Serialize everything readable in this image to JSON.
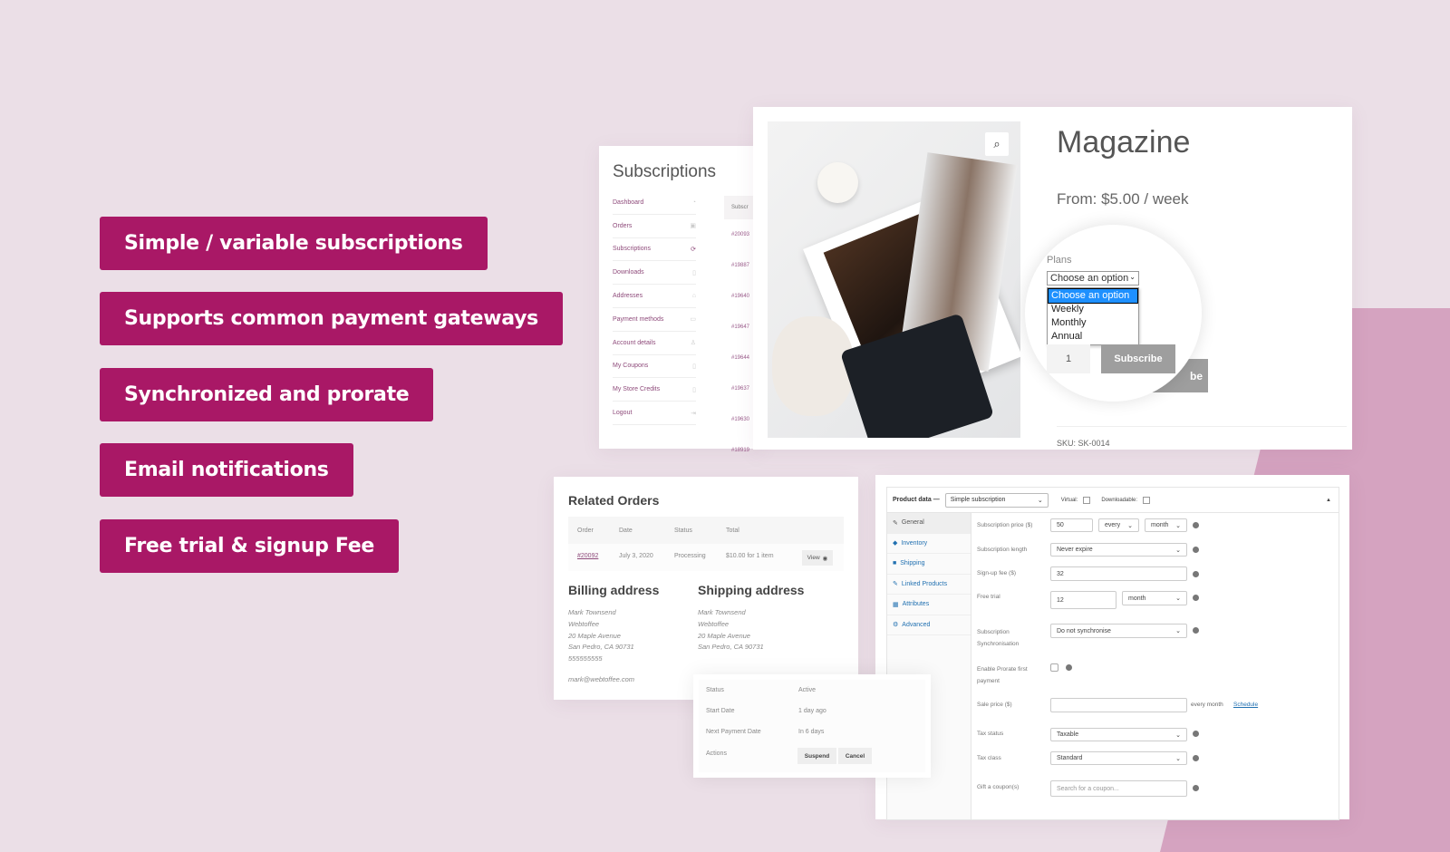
{
  "colors": {
    "accent": "#a91866",
    "background": "#ebdfe7",
    "blob": "#d5a3c0"
  },
  "features": [
    "Simple / variable subscriptions",
    "Supports common payment gateways",
    "Synchronized and prorate",
    "Email notifications",
    "Free trial & signup Fee"
  ],
  "account": {
    "title": "Subscriptions",
    "nav": [
      {
        "label": "Dashboard",
        "icon": "dashboard-icon"
      },
      {
        "label": "Orders",
        "icon": "orders-icon"
      },
      {
        "label": "Subscriptions",
        "icon": "refresh-icon"
      },
      {
        "label": "Downloads",
        "icon": "file-icon"
      },
      {
        "label": "Addresses",
        "icon": "home-icon"
      },
      {
        "label": "Payment methods",
        "icon": "card-icon"
      },
      {
        "label": "Account details",
        "icon": "user-icon"
      },
      {
        "label": "My Coupons",
        "icon": "coupon-icon"
      },
      {
        "label": "My Store Credits",
        "icon": "credit-icon"
      },
      {
        "label": "Logout",
        "icon": "logout-icon"
      }
    ],
    "column_header": "Subscr",
    "rows": [
      "#20093",
      "#19887",
      "#19640",
      "#19647",
      "#19644",
      "#19637",
      "#19630",
      "#18919"
    ]
  },
  "product": {
    "title": "Magazine",
    "price": "From: $5.00 / week",
    "plans_label": "Plans",
    "select_value": "Choose an option",
    "options": [
      "Choose an option",
      "Weekly",
      "Monthly",
      "Annual"
    ],
    "quantity": "1",
    "subscribe": "Subscribe",
    "subscribe_behind": "be",
    "sku": "SKU: SK-0014",
    "zoom_icon": "magnifier-icon"
  },
  "related": {
    "title": "Related Orders",
    "headers": [
      "Order",
      "Date",
      "Status",
      "Total"
    ],
    "row": {
      "order": "#20092",
      "date": "July 3, 2020",
      "status": "Processing",
      "total": "$10.00 for 1 item",
      "view": "View"
    },
    "billing_title": "Billing address",
    "billing": [
      "Mark Townsend",
      "Webtoffee",
      "20 Maple Avenue",
      "San Pedro, CA 90731",
      "555555555"
    ],
    "email": "mark@webtoffee.com",
    "shipping_title": "Shipping address",
    "shipping": [
      "Mark Townsend",
      "Webtoffee",
      "20 Maple Avenue",
      "San Pedro, CA 90731"
    ]
  },
  "status_box": {
    "rows": [
      [
        "Status",
        "Active"
      ],
      [
        "Start Date",
        "1 day ago"
      ],
      [
        "Next Payment Date",
        "In 6 days"
      ]
    ],
    "actions_label": "Actions",
    "suspend": "Suspend",
    "cancel": "Cancel"
  },
  "product_data": {
    "label": "Product data —",
    "type": "Simple subscription",
    "virtual": "Virtual:",
    "downloadable": "Downloadable:",
    "tabs": [
      "General",
      "Inventory",
      "Shipping",
      "Linked Products",
      "Attributes",
      "Advanced"
    ],
    "price_label": "Subscription price ($)",
    "price": "50",
    "every": "every",
    "period": "month",
    "length_label": "Subscription length",
    "length": "Never expire",
    "signup_label": "Sign-up fee ($)",
    "signup": "32",
    "trial_label": "Free trial",
    "trial": "12",
    "trial_period": "month",
    "sync_label": "Subscription Synchronisation",
    "sync": "Do not synchronise",
    "prorate_label": "Enable Prorate first payment",
    "sale_label": "Sale price ($)",
    "sale_suffix": "every month",
    "schedule": "Schedule",
    "tax_status_label": "Tax status",
    "tax_status": "Taxable",
    "tax_class_label": "Tax class",
    "tax_class": "Standard",
    "coupon_label": "Gift a coupon(s)",
    "coupon_placeholder": "Search for a coupon..."
  }
}
